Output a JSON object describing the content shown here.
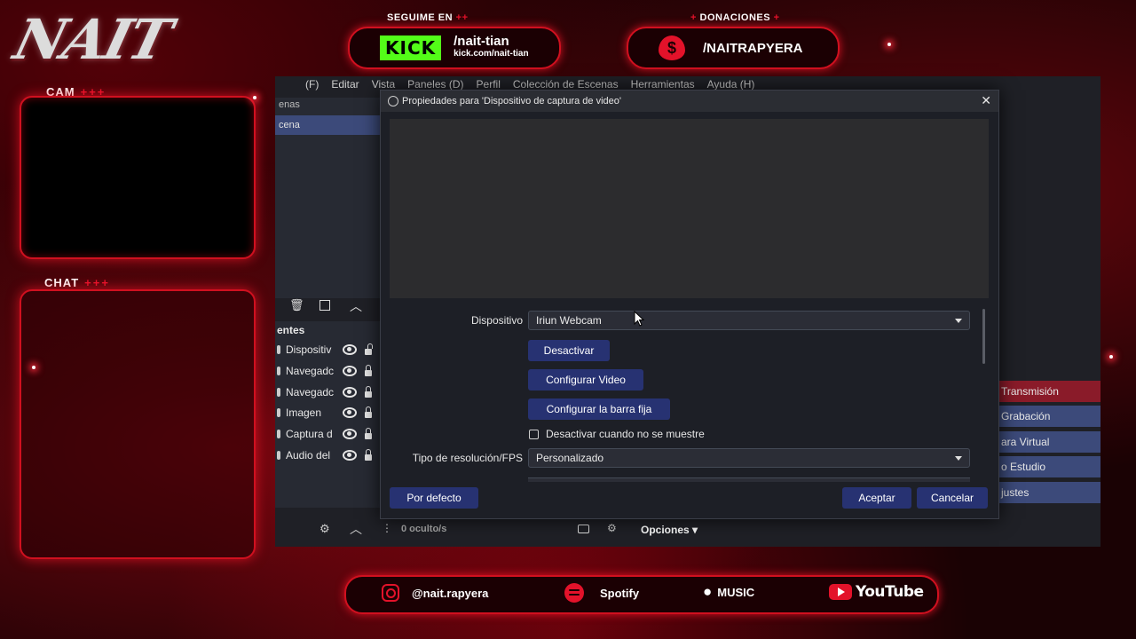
{
  "overlay": {
    "logo_text": "NAIT",
    "cam_label": "CAM",
    "chat_label": "CHAT",
    "plus_marks": "+++",
    "follow_label": "SEGUIME EN",
    "follow_plus": "++",
    "kick_logo": "KICK",
    "kick_handle": "/nait-tian",
    "kick_url": "kick.com/nait-tian",
    "donations_label": "DONACIONES",
    "donations_plus": "+",
    "donations_symbol": "$",
    "donations_handle": "/NAITRAPYERA",
    "social": {
      "instagram": "@nait.rapyera",
      "spotify": "Spotify",
      "apple_music": "MUSIC",
      "youtube": "YouTube"
    },
    "accent_color": "#e3122a",
    "kick_color": "#53fc18"
  },
  "obs": {
    "menu": [
      "(F)",
      "Editar",
      "Vista",
      "Paneles (D)",
      "Perfil",
      "Colección de Escenas",
      "Herramientas",
      "Ayuda (H)"
    ],
    "scenes_header": "enas",
    "scene_item": "cena",
    "sources_header": "entes",
    "sources": [
      {
        "name": "Dispositiv",
        "locked": false
      },
      {
        "name": "Navegadc",
        "locked": true
      },
      {
        "name": "Navegadc",
        "locked": true
      },
      {
        "name": "Imagen",
        "locked": true
      },
      {
        "name": "Captura d",
        "locked": true
      },
      {
        "name": "Audio del",
        "locked": true
      }
    ],
    "controls": [
      "Transmisión",
      "Grabación",
      "ara Virtual",
      "o Estudio",
      "justes"
    ],
    "hidden_count": "0 oculto/s",
    "options_label": "Opciones"
  },
  "dialog": {
    "title": "Propiedades para 'Dispositivo de captura de video'",
    "device_label": "Dispositivo",
    "device_value": "Iriun Webcam",
    "deactivate": "Desactivar",
    "configure_video": "Configurar Video",
    "configure_crossbar": "Configurar la barra fija",
    "hide_checkbox_label": "Desactivar cuando no se muestre",
    "resolution_label": "Tipo de resolución/FPS",
    "resolution_value": "Personalizado",
    "defaults": "Por defecto",
    "accept": "Aceptar",
    "cancel": "Cancelar",
    "close_symbol": "✕",
    "button_color": "#273272"
  }
}
